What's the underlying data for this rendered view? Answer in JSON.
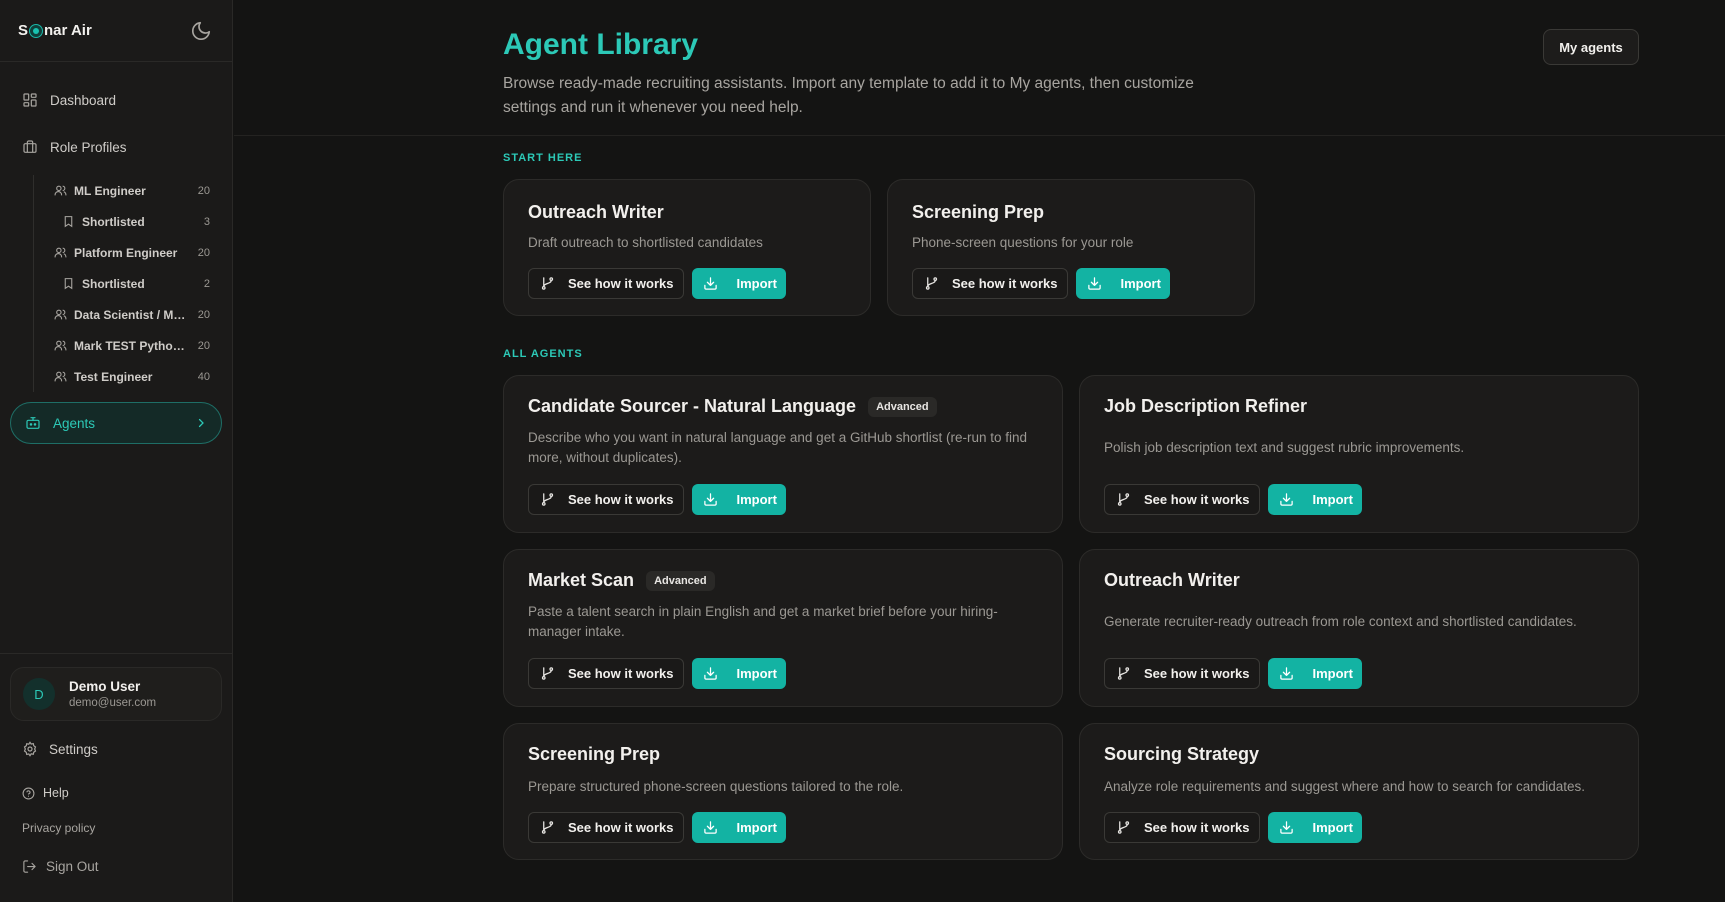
{
  "sidebar": {
    "brand": {
      "prefix": "S",
      "suffix": "nar Air"
    },
    "nav": {
      "dashboard": "Dashboard",
      "role_profiles": "Role Profiles",
      "agents": "Agents"
    },
    "roles": [
      {
        "name": "ML Engineer",
        "count": "20"
      },
      {
        "name": "Shortlisted",
        "count": "3"
      },
      {
        "name": "Platform Engineer",
        "count": "20"
      },
      {
        "name": "Shortlisted",
        "count": "2"
      },
      {
        "name": "Data Scientist / ML ...",
        "count": "20"
      },
      {
        "name": "Mark TEST Python ...",
        "count": "20"
      },
      {
        "name": "Test Engineer",
        "count": "40"
      }
    ],
    "user": {
      "initial": "D",
      "name": "Demo User",
      "email": "demo@user.com"
    },
    "links": {
      "settings": "Settings",
      "help": "Help",
      "privacy": "Privacy policy",
      "sign_out": "Sign Out"
    }
  },
  "header": {
    "title": "Agent Library",
    "description": "Browse ready-made recruiting assistants. Import any template to add it to My agents, then customize settings and run it whenever you need help.",
    "my_agents_button": "My agents"
  },
  "sections": {
    "start_here": "START HERE",
    "all_agents": "ALL AGENTS"
  },
  "buttons": {
    "how": "See how it works",
    "import": "Import"
  },
  "start_cards": [
    {
      "title": "Outreach Writer",
      "desc": "Draft outreach to shortlisted candidates"
    },
    {
      "title": "Screening Prep",
      "desc": "Phone-screen questions for your role"
    }
  ],
  "all_cards": [
    {
      "title": "Candidate Sourcer - Natural Language",
      "badge": "Advanced",
      "desc": "Describe who you want in natural language and get a GitHub shortlist (re-run to find more, without duplicates)."
    },
    {
      "title": "Job Description Refiner",
      "badge": "",
      "desc": "Polish job description text and suggest rubric improvements."
    },
    {
      "title": "Market Scan",
      "badge": "Advanced",
      "desc": "Paste a talent search in plain English and get a market brief before your hiring-manager intake."
    },
    {
      "title": "Outreach Writer",
      "badge": "",
      "desc": "Generate recruiter-ready outreach from role context and shortlisted candidates."
    },
    {
      "title": "Screening Prep",
      "badge": "",
      "desc": "Prepare structured phone-screen questions tailored to the role."
    },
    {
      "title": "Sourcing Strategy",
      "badge": "",
      "desc": "Analyze role requirements and suggest where and how to search for candidates."
    }
  ],
  "colors": {
    "accent": "#2cc9b7",
    "import_button": "#13b3a3",
    "background": "#141413",
    "card": "#1c1b1a"
  },
  "icons": {
    "dashboard": "grid-icon",
    "role_profiles": "briefcase-icon",
    "role": "users-icon",
    "shortlisted": "bookmark-icon",
    "agents": "robot-icon",
    "how": "branch-icon",
    "import": "download-icon"
  }
}
